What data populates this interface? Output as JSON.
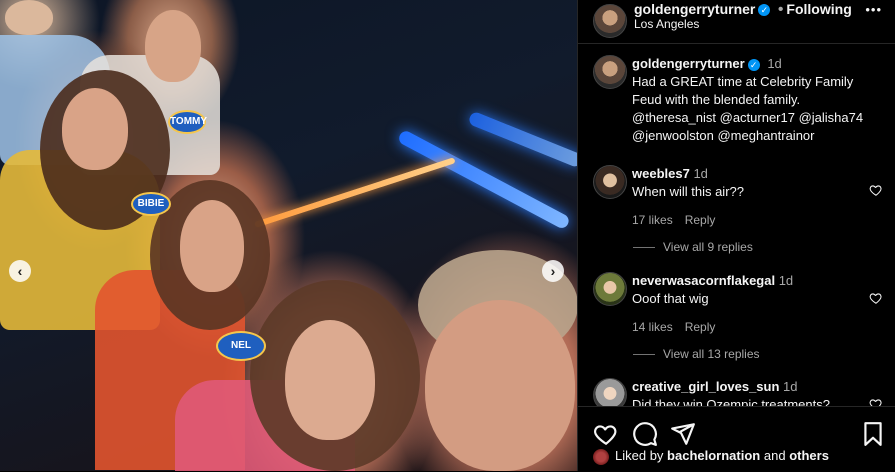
{
  "post": {
    "author": "goldengerryturner",
    "follow_separator": "•",
    "follow_status": "Following",
    "location": "Los Angeles",
    "more_label": "•••",
    "caption_age": "1d",
    "caption": "Had a GREAT time at Celebrity Family Feud with the blended family. @theresa_nist @acturner17 @jalisha74 @jenwoolston @meghantrainor",
    "nametags": [
      "TOMMY",
      "BIBIE",
      "NEL"
    ],
    "carousel_prev": "‹",
    "carousel_next": "›"
  },
  "comments": [
    {
      "username": "weebles7",
      "age": "1d",
      "text": "When will this air??",
      "likes": "17 likes",
      "reply": "Reply",
      "view_replies": "View all 9 replies"
    },
    {
      "username": "neverwasacornflakegal",
      "age": "1d",
      "text": "Ooof that wig",
      "likes": "14 likes",
      "reply": "Reply",
      "view_replies": "View all 13 replies"
    },
    {
      "username": "creative_girl_loves_sun",
      "age": "1d",
      "text": "Did they win Ozempic treatments?"
    }
  ],
  "liked_by": {
    "prefix": "Liked by",
    "user": "bachelornation",
    "connector": "and",
    "others": "others"
  },
  "icons": [
    "verified-icon",
    "more-icon",
    "heart-icon",
    "comment-icon",
    "share-icon",
    "bookmark-icon"
  ],
  "colors": {
    "verified": "#0095f6",
    "background": "#000000",
    "muted": "#a8a8a8"
  }
}
